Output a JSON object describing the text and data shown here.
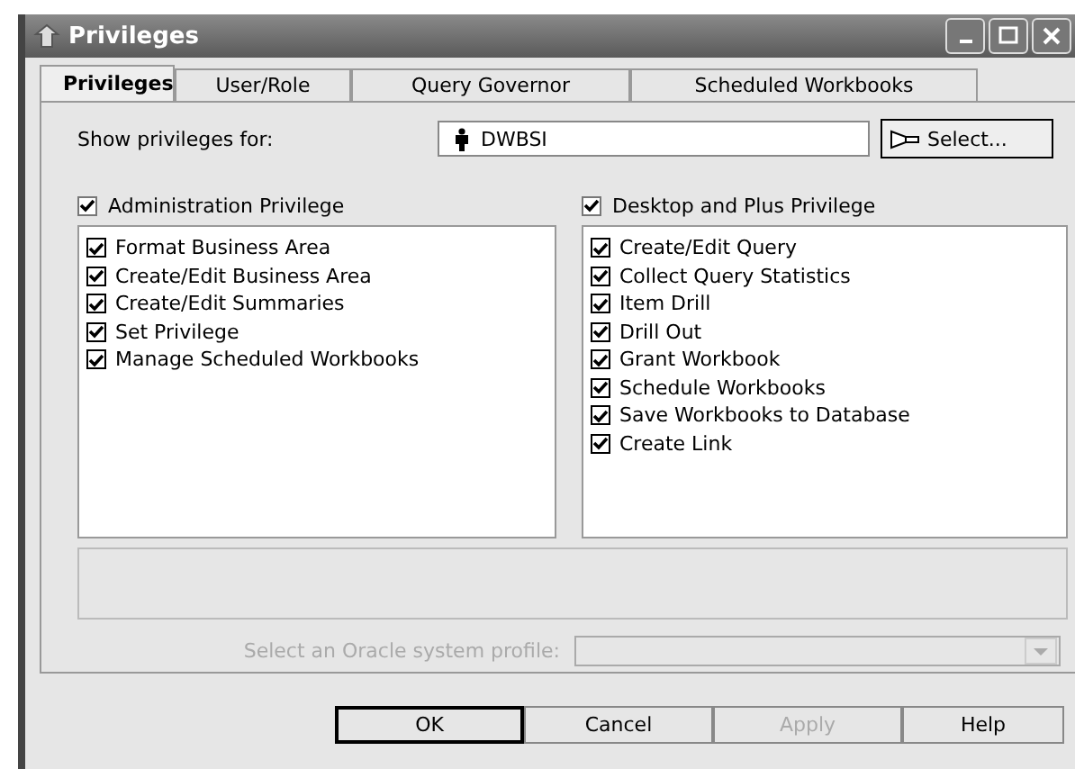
{
  "window": {
    "title": "Privileges"
  },
  "tabs": [
    {
      "label": "Privileges",
      "selected": true
    },
    {
      "label": "User/Role",
      "selected": false
    },
    {
      "label": "Query Governor",
      "selected": false
    },
    {
      "label": "Scheduled Workbooks",
      "selected": false
    }
  ],
  "show_for": {
    "label": "Show privileges for:",
    "value": "DWBSI",
    "button": "Select..."
  },
  "groups": [
    {
      "label": "Administration Privilege",
      "checked": true,
      "items": [
        {
          "label": "Format Business Area",
          "checked": true
        },
        {
          "label": "Create/Edit Business Area",
          "checked": true
        },
        {
          "label": "Create/Edit Summaries",
          "checked": true
        },
        {
          "label": "Set Privilege",
          "checked": true
        },
        {
          "label": "Manage Scheduled Workbooks",
          "checked": true
        }
      ]
    },
    {
      "label": "Desktop and Plus Privilege",
      "checked": true,
      "items": [
        {
          "label": "Create/Edit Query",
          "checked": true
        },
        {
          "label": "Collect Query Statistics",
          "checked": true
        },
        {
          "label": "Item Drill",
          "checked": true
        },
        {
          "label": "Drill Out",
          "checked": true
        },
        {
          "label": "Grant Workbook",
          "checked": true
        },
        {
          "label": "Schedule Workbooks",
          "checked": true
        },
        {
          "label": "Save Workbooks to Database",
          "checked": true
        },
        {
          "label": "Create Link",
          "checked": true
        }
      ]
    }
  ],
  "profile": {
    "label": "Select an Oracle system profile:",
    "disabled": true
  },
  "buttons": [
    {
      "label": "OK",
      "disabled": false,
      "default": true
    },
    {
      "label": "Cancel",
      "disabled": false,
      "default": false
    },
    {
      "label": "Apply",
      "disabled": true,
      "default": false
    },
    {
      "label": "Help",
      "disabled": false,
      "default": false
    }
  ]
}
